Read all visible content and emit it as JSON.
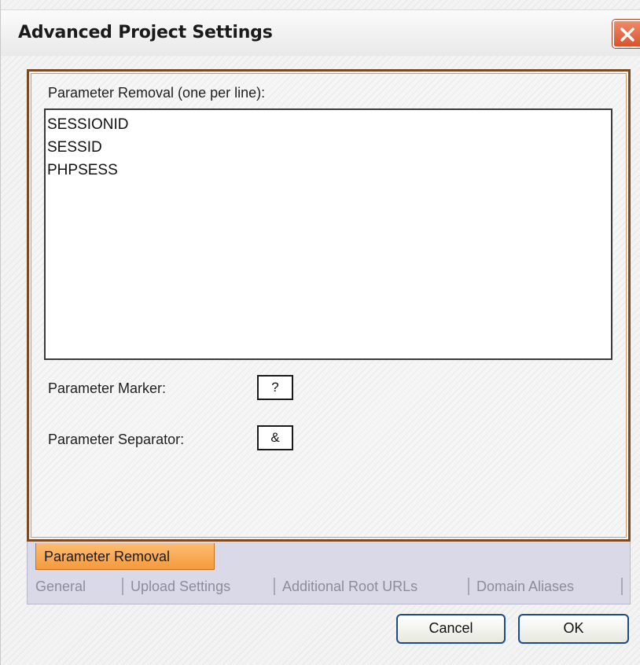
{
  "window": {
    "title": "Advanced Project Settings"
  },
  "parameters": {
    "removal_label": "Parameter Removal (one per line):",
    "removal_value": "SESSIONID\nSESSID\nPHPSESS",
    "marker_label": "Parameter Marker:",
    "marker_value": "?",
    "separator_label": "Parameter Separator:",
    "separator_value": "&"
  },
  "tabs": {
    "active": "Parameter Removal",
    "items": [
      "General",
      "Upload Settings",
      "Additional Root URLs",
      "Domain Aliases"
    ]
  },
  "buttons": {
    "cancel": "Cancel",
    "ok": "OK"
  },
  "colors": {
    "active_tab": "#f59a3e",
    "close_button": "#d9532b",
    "panel_border": "#7a4a22",
    "button_border": "#1c4a8a"
  },
  "icons": {
    "close": "close-icon"
  }
}
